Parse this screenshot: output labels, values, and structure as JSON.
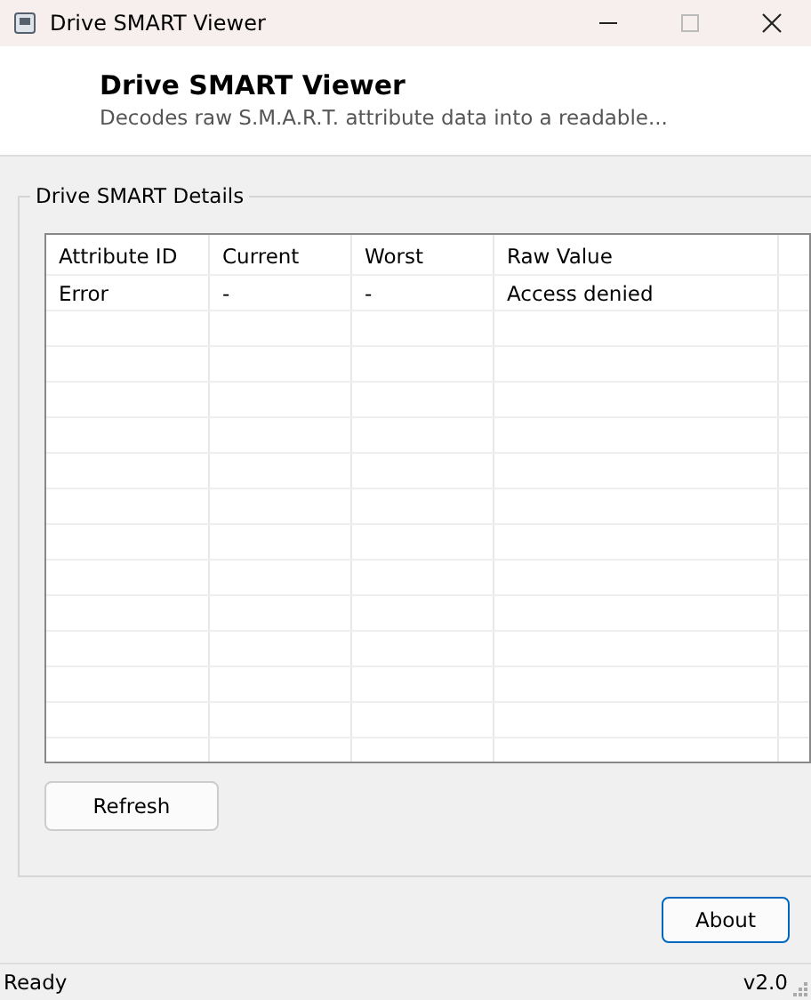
{
  "window": {
    "title": "Drive SMART Viewer"
  },
  "header": {
    "title": "Drive SMART Viewer",
    "subtitle": "Decodes raw S.M.A.R.T. attribute data into a readable..."
  },
  "group": {
    "title": "Drive SMART Details"
  },
  "table": {
    "columns": [
      "Attribute ID",
      "Current",
      "Worst",
      "Raw Value"
    ],
    "rows": [
      [
        "Error",
        "-",
        "-",
        "Access denied"
      ]
    ]
  },
  "buttons": {
    "refresh": "Refresh",
    "about": "About"
  },
  "status_bar": {
    "text": "Ready",
    "version": "v2.0"
  }
}
